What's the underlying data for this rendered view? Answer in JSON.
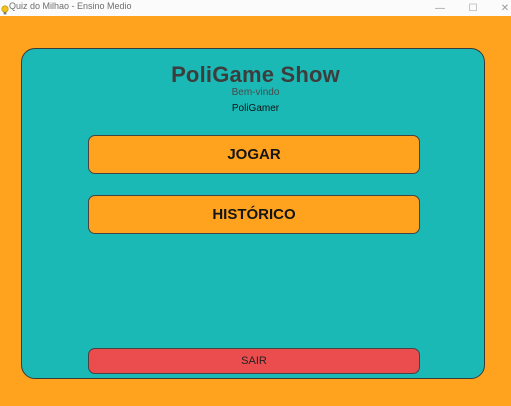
{
  "window": {
    "title": "Quiz do Milhao - Ensino Medio",
    "icon": "lightbulb-icon",
    "controls": {
      "minimize": "—",
      "maximize": "☐",
      "close": "✕"
    }
  },
  "colors": {
    "background": "#ffa31f",
    "card": "#1ab9b6",
    "primary_button": "#ffa31f",
    "exit_button": "#eb4d4f"
  },
  "header": {
    "title": "PoliGame Show",
    "welcome": "Bem-vindo",
    "username": "PoliGamer"
  },
  "menu": {
    "play_label": "JOGAR",
    "history_label": "HISTÓRICO",
    "exit_label": "SAIR"
  }
}
